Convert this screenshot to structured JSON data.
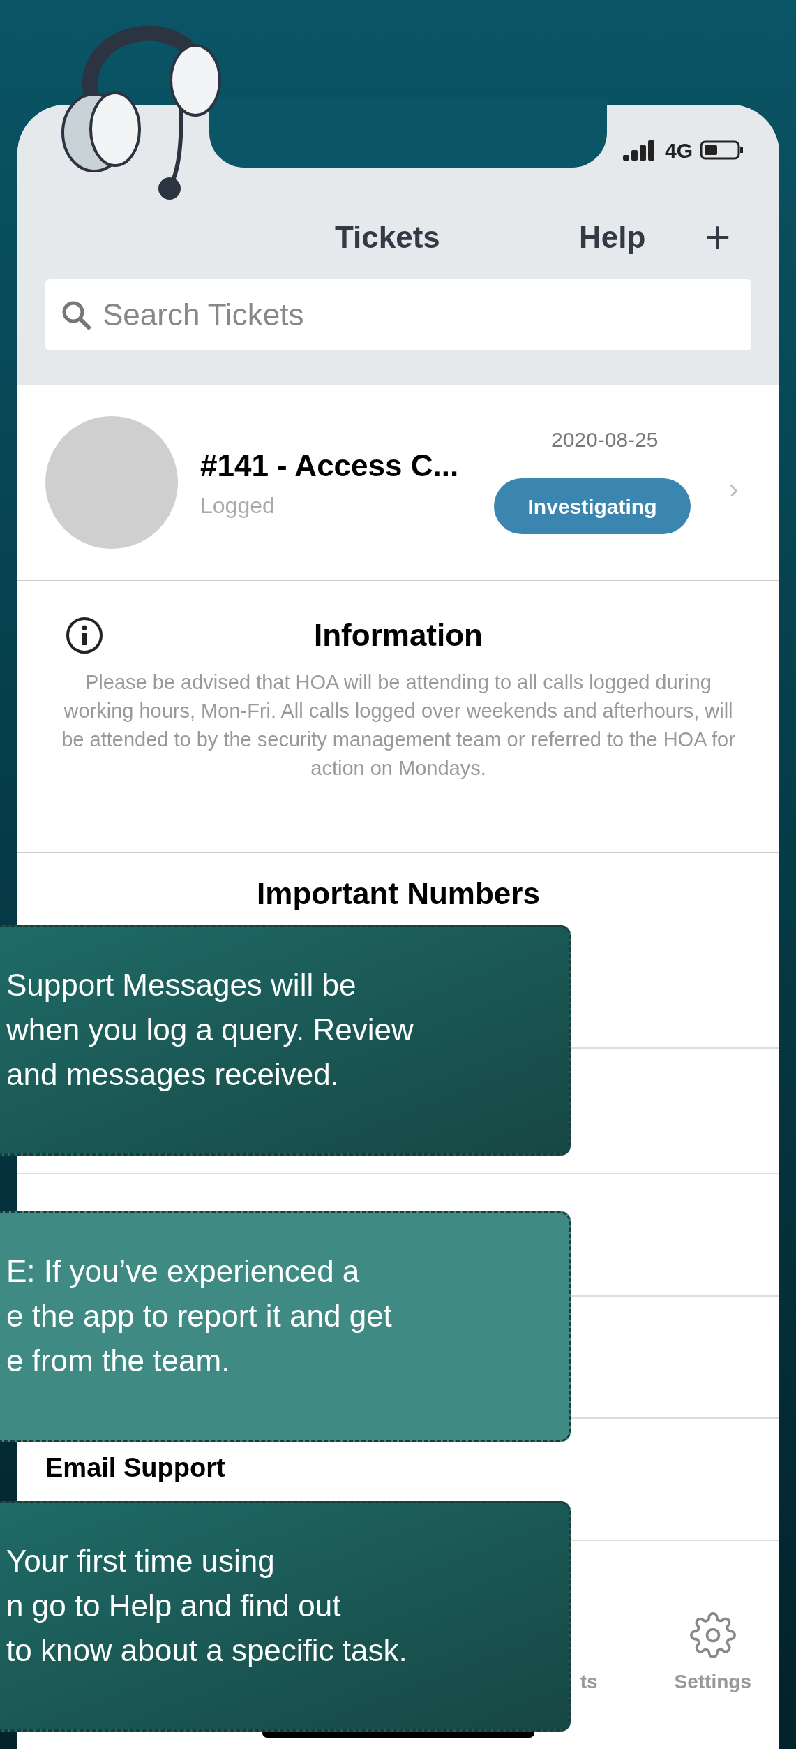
{
  "status_bar": {
    "network": "4G"
  },
  "nav": {
    "title": "Tickets",
    "help": "Help",
    "add": "+"
  },
  "search": {
    "placeholder": "Search Tickets"
  },
  "ticket": {
    "title": "#141 - Access C...",
    "subtitle": "Logged",
    "date": "2020-08-25",
    "status": "Investigating",
    "chevron": "›"
  },
  "information": {
    "title": "Information",
    "text": "Please be advised that HOA will be attending to all calls logged during working hours, Mon-Fri. All calls  logged over weekends and afterhours, will be attended to by the security management team or referred to the HOA for action on Mondays."
  },
  "important_numbers": {
    "title": "Important Numbers"
  },
  "contacts": [
    {
      "title": "Email Support"
    }
  ],
  "tab_bar": [
    {
      "label": "ts",
      "kind": "tickets"
    },
    {
      "label": "Settings",
      "kind": "settings"
    }
  ],
  "callouts": [
    {
      "lines": [
        "Support Messages will be",
        "when you log a query. Review",
        "and messages received."
      ],
      "translucent": false
    },
    {
      "lines": [
        "E: If you’ve experienced a",
        "e the app to report it and get",
        "e from the team."
      ],
      "translucent": true
    },
    {
      "lines": [
        "Your first time using",
        "n go to Help and find out",
        "to know about a specific task."
      ],
      "translucent": false
    }
  ]
}
